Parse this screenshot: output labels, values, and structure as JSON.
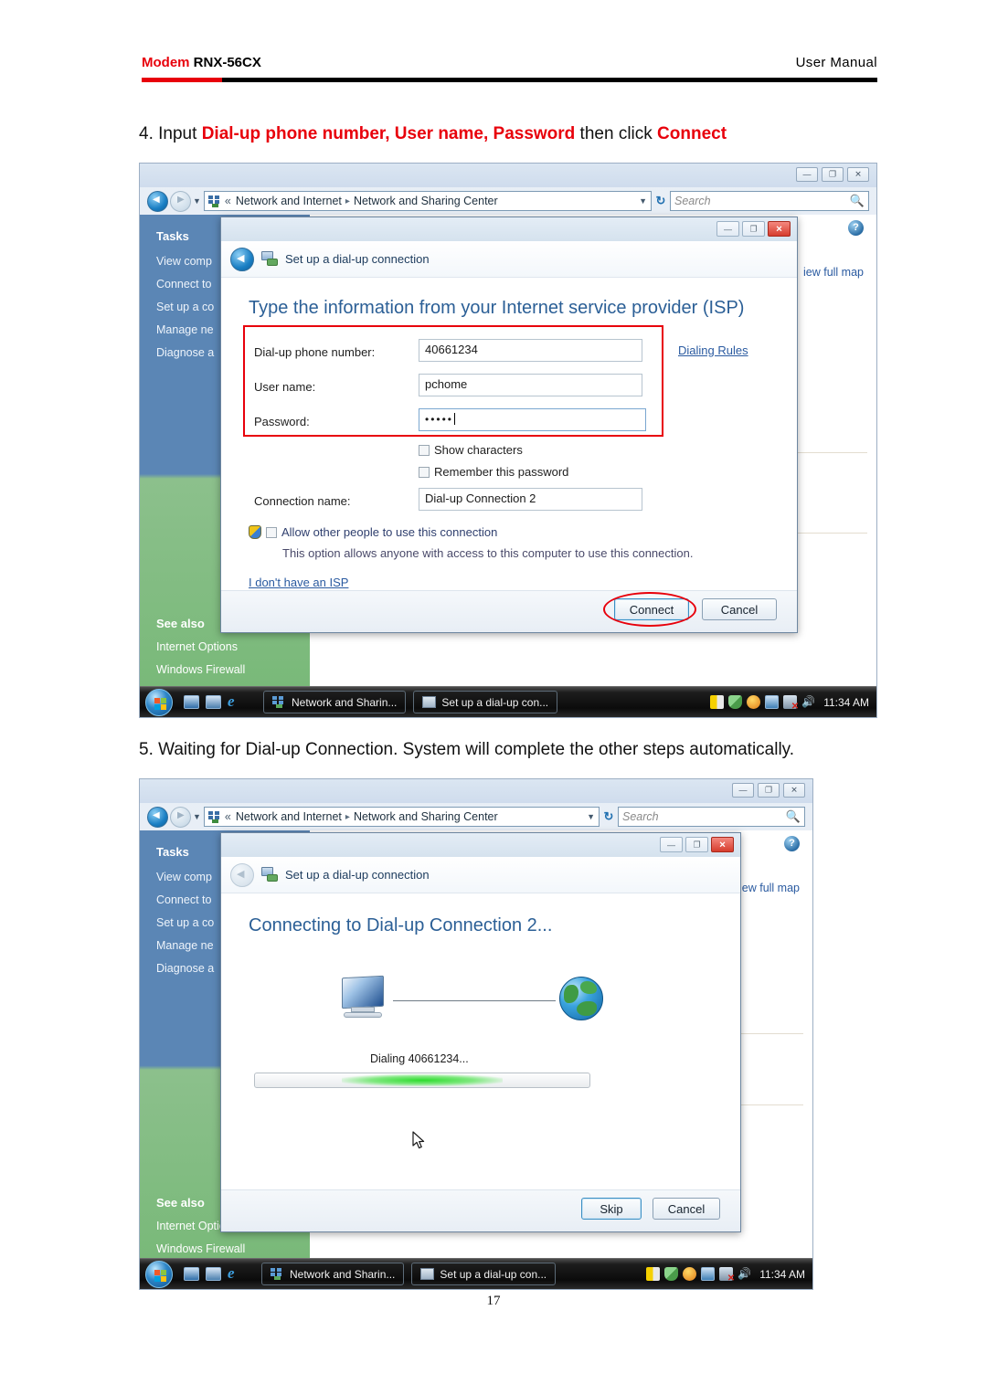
{
  "document": {
    "header": {
      "brand": "Modem",
      "model": "RNX-56CX",
      "right_label": "User Manual"
    },
    "page_number": "17",
    "steps": [
      {
        "number": "4.",
        "prefix": " Input ",
        "highlight_1": "Dial-up phone number, User name, Password",
        "middle": " then click ",
        "highlight_2": "Connect"
      },
      {
        "number": "5.",
        "text": " Waiting for Dial-up Connection. System will complete the other steps automatically."
      }
    ]
  },
  "screenshot_1": {
    "explorer": {
      "window_buttons": [
        "minimize",
        "maximize",
        "close"
      ],
      "window_button_glyphs": [
        "—",
        "❐",
        "✕"
      ],
      "breadcrumb": {
        "overflow": "«",
        "items": [
          "Network and Internet",
          "Network and Sharing Center"
        ],
        "separator": "▸"
      },
      "search_placeholder": "Search",
      "search_icon": "search-icon",
      "refresh_icon": "↻",
      "help_icon": "?",
      "view_full_map": "iew full map"
    },
    "sidebar": {
      "tasks_heading": "Tasks",
      "items": [
        "View comp",
        "Connect to",
        "Set up a co",
        "Manage ne",
        "Diagnose a"
      ],
      "see_also_heading": "See also",
      "see_also_items": [
        "Internet Options",
        "Windows Firewall"
      ]
    },
    "wizard": {
      "title": "Set up a dial-up connection",
      "heading": "Type the information from your Internet service provider (ISP)",
      "fields": [
        {
          "label": "Dial-up phone number:",
          "value": "40661234"
        },
        {
          "label": "User name:",
          "value": "pchome"
        },
        {
          "label": "Password:",
          "value": "•••••"
        }
      ],
      "dialing_rules_link": "Dialing Rules",
      "checkboxes": [
        {
          "label": "Show characters",
          "checked": false
        },
        {
          "label": "Remember this password",
          "checked": false
        }
      ],
      "connection_name_label": "Connection name:",
      "connection_name_value": "Dial-up Connection 2",
      "allow_others_label": "Allow other people to use this connection",
      "allow_others_note": "This option allows anyone with access to this computer to use this connection.",
      "no_isp_link": "I don't have an ISP",
      "buttons": {
        "primary": "Connect",
        "secondary": "Cancel"
      },
      "window_button_glyphs": [
        "—",
        "❐",
        "✕"
      ]
    },
    "taskbar": {
      "start_label": "start-orb",
      "quick_launch": [
        "show-desktop-icon",
        "switch-windows-icon",
        "internet-explorer-icon"
      ],
      "buttons": [
        "Network and Sharin...",
        "Set up a dial-up con..."
      ],
      "clock": "11:34 AM"
    }
  },
  "screenshot_2": {
    "explorer": {
      "breadcrumb": {
        "overflow": "«",
        "items": [
          "Network and Internet",
          "Network and Sharing Center"
        ],
        "separator": "▸"
      },
      "search_placeholder": "Search",
      "help_icon": "?",
      "view_full_map": "iew full map"
    },
    "sidebar": {
      "tasks_heading": "Tasks",
      "items": [
        "View comp",
        "Connect to",
        "Set up a co",
        "Manage ne",
        "Diagnose a"
      ],
      "see_also_heading": "See also",
      "see_also_items": [
        "Internet Options",
        "Windows Firewall"
      ]
    },
    "wizard": {
      "title": "Set up a dial-up connection",
      "heading": "Connecting to Dial-up Connection 2...",
      "status_text": "Dialing 40661234...",
      "progress_state": "indeterminate",
      "buttons": {
        "primary": "Skip",
        "secondary": "Cancel"
      },
      "window_button_glyphs": [
        "—",
        "❐",
        "✕"
      ]
    },
    "taskbar": {
      "buttons": [
        "Network and Sharin...",
        "Set up a dial-up con..."
      ],
      "clock": "11:34 AM"
    }
  },
  "colors": {
    "accent_red": "#e8000b",
    "link_blue": "#2a5aa0",
    "sidebar_blue": "#5b86b5",
    "sidebar_green": "#8cc08c",
    "progress_green": "#2ddc2d"
  }
}
